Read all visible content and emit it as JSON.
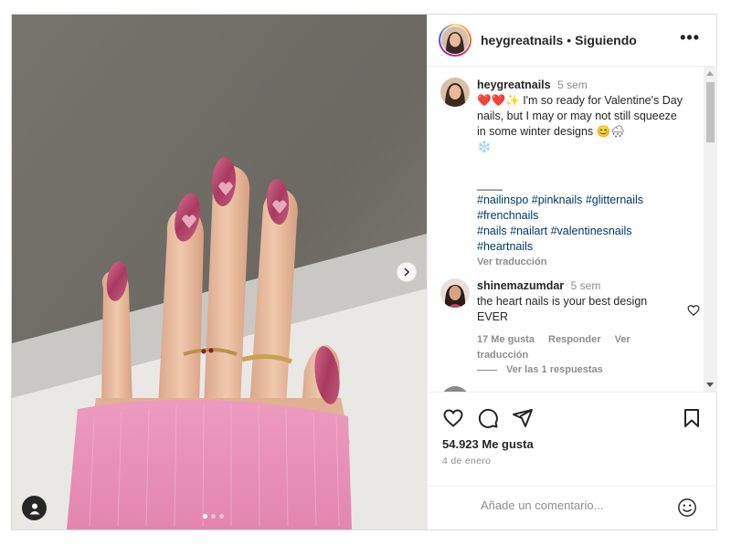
{
  "header": {
    "username": "heygreatnails",
    "separator": "•",
    "follow_status": "Siguiendo",
    "more_label": "•••"
  },
  "caption": {
    "username": "heygreatnails",
    "time": "5 sem",
    "emojis_start": "❤️❤️✨",
    "text": "I'm so ready for Valentine's Day nails, but I may or may not still squeeze in some winter designs 😊🌨",
    "emoji_end": "❄️",
    "divider": "____",
    "hashtags": [
      "#nailinspo #pinknails #glitternails",
      "#frenchnails",
      "#nails #nailart #valentinesnails",
      "#heartnails"
    ],
    "translate_label": "Ver traducción"
  },
  "comment": {
    "username": "shinemazumdar",
    "time": "5 sem",
    "text": "the heart nails is your best design EVER",
    "likes_label": "17 Me gusta",
    "reply_label": "Responder",
    "translate_label": "Ver traducción",
    "view_replies_label": "Ver las 1 respuestas"
  },
  "actions": {
    "likes_count": "54.923 Me gusta",
    "date": "4 de enero"
  },
  "add_comment": {
    "placeholder": "Añade un comentario..."
  },
  "colors": {
    "link": "#00376b",
    "muted": "#8e8e8e",
    "text": "#262626",
    "sweater": "#e98fb4",
    "nail": "#b3476b"
  },
  "carousel": {
    "current_slide": 1,
    "total_slides": 3
  }
}
